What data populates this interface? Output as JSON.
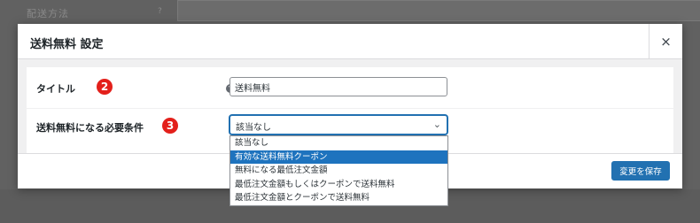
{
  "background": {
    "label": "配送方法"
  },
  "modal": {
    "title": "送料無料 設定",
    "close_label": "×",
    "fields": {
      "title_label": "タイトル",
      "title_badge": "2",
      "title_value": "送料無料",
      "requires_label": "送料無料になる必要条件",
      "requires_badge": "3",
      "requires_selected": "該当なし"
    },
    "dropdown": {
      "options": [
        "該当なし",
        "有効な送料無料クーポン",
        "無料になる最低注文金額",
        "最低注文金額もしくはクーポンで送料無料",
        "最低注文金額とクーポンで送料無料"
      ],
      "highlighted_index": 1
    },
    "save_label": "変更を保存"
  },
  "icons": {
    "help": "help-icon",
    "close": "close-icon",
    "chevron": "chevron-down-icon"
  },
  "colors": {
    "primary": "#2271b1",
    "highlight": "#1e73be",
    "badge": "#e3201b"
  }
}
